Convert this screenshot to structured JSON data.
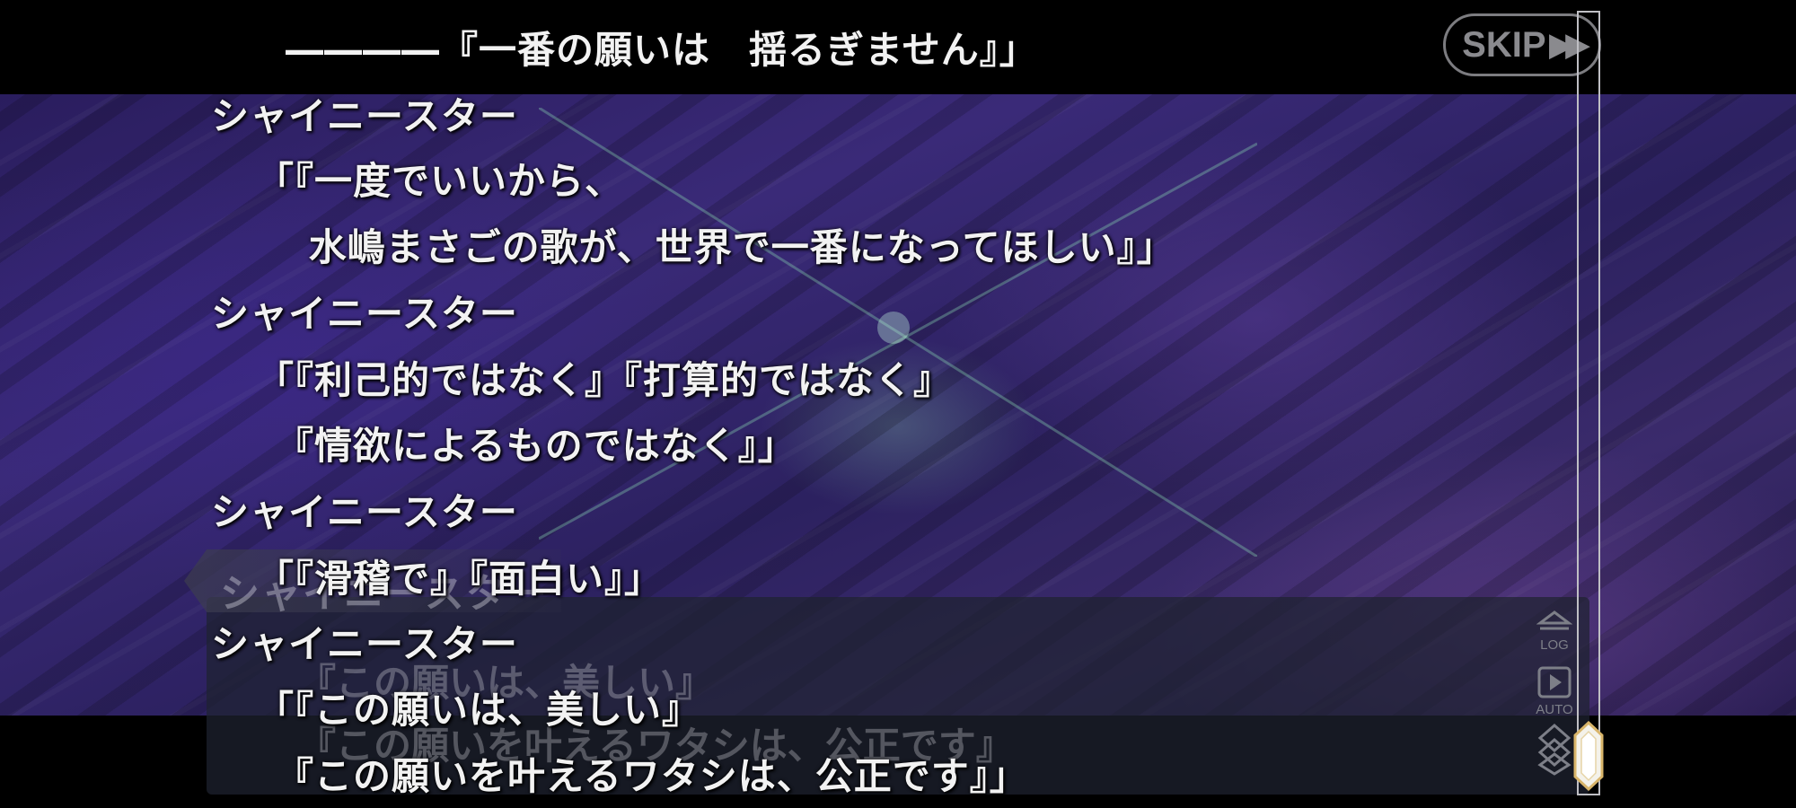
{
  "top_line": "――――『一番の願いは　揺るぎません』」",
  "skip": {
    "label": "SKIP",
    "icon": "fast-forward-icon"
  },
  "log": [
    {
      "speaker": "シャイニースター",
      "lines": [
        "「『一度でいいから、",
        "　 水嶋まさごの歌が、世界で一番になってほしい』」"
      ]
    },
    {
      "speaker": "シャイニースター",
      "lines": [
        "「『利己的ではなく』『打算的ではなく』",
        "　『情欲によるものではなく』」"
      ]
    },
    {
      "speaker": "シャイニースター",
      "lines": [
        "「『滑稽で』『面白い』」"
      ]
    },
    {
      "speaker": "シャイニースター",
      "lines": [
        "「『この願いは、美しい』",
        "　『この願いを叶えるワタシは、公正です』」"
      ]
    }
  ],
  "background_dialogue": {
    "nameplate": "シャイニースター",
    "lines": [
      "『この願いは、美しい』",
      "『この願いを叶えるワタシは、公正です』"
    ]
  },
  "controls": {
    "log": {
      "label": "LOG",
      "icon": "log-icon"
    },
    "auto": {
      "label": "AUTO",
      "icon": "play-icon"
    },
    "menu": {
      "icon": "diamond-menu-icon"
    }
  },
  "colors": {
    "text": "#f2f2f2",
    "accent_gold": "#d9b56a",
    "skip_gray": "#7c7c80"
  }
}
